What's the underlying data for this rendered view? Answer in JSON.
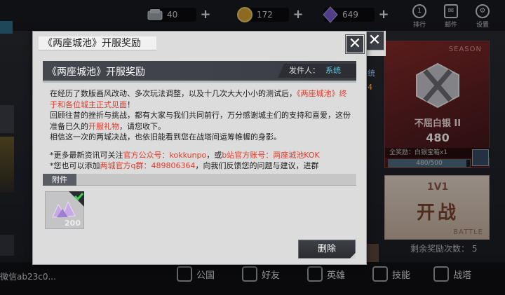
{
  "resources": [
    {
      "name": "silver",
      "value": "40",
      "icon": "silver-ingot-icon"
    },
    {
      "name": "gold",
      "value": "172",
      "icon": "gold-coin-icon"
    },
    {
      "name": "gem",
      "value": "649",
      "icon": "purple-gem-icon"
    }
  ],
  "top_buttons": [
    {
      "label": "排行",
      "icon": "ranking-icon",
      "glyph": "1"
    },
    {
      "label": "邮件",
      "icon": "mail-icon",
      "glyph": "✉"
    },
    {
      "label": "设置",
      "icon": "settings-icon",
      "glyph": "⚙"
    }
  ],
  "rank_card": {
    "season": "SEASON",
    "rank_name": "不屈白银 II",
    "score": "480",
    "reward_text": "全奖励：白银宝箱x1",
    "progress_text": "480/500",
    "progress_fraction": 0.96
  },
  "battle_card": {
    "mode": "1V1",
    "action": "开战",
    "tag": "BATTLE"
  },
  "remaining": "剩余奖励次数： 5",
  "username": "微信ab23c0...",
  "bottom_nav": [
    {
      "label": "公国",
      "icon": "crown-icon"
    },
    {
      "label": "好友",
      "icon": "friends-icon"
    },
    {
      "label": "英雄",
      "icon": "hero-icon"
    },
    {
      "label": "技能",
      "icon": "skill-icon"
    },
    {
      "label": "战塔",
      "icon": "tower-icon"
    }
  ],
  "back_panel": {
    "side_text": "统",
    "side_num": "4"
  },
  "dialog": {
    "title": "《两座城池》开服奖励",
    "close_symbol": "✕",
    "mail_title": "《两座城池》开服奖励",
    "sender_label": "发件人：",
    "sender_name": "系统",
    "body": {
      "p1_a": "在经历了数版画风改动、多次玩法调整，以及十几次大大小小的测试后，",
      "p1_hl": "《两座城池》终于和各位城主正式见面",
      "p1_b": "！",
      "p2_a": "回顾往昔的挫折与挑战，都有大家与我们共同前行，万分感谢城主们的支持和喜爱，这份准备已久的",
      "p2_hl": "开服礼物",
      "p2_b": "，请您收下。",
      "p3": "相信这一次的两城决战，也依旧能看到您在战塔间运筹帷幄的身影。",
      "p4_a": "*更多最新资讯可关注",
      "p4_hl1": "官方公众号：kokkunpo",
      "p4_b": "，或",
      "p4_hl2": "b站官方账号：两座城池KOK",
      "p5_a": "*您也可以添加",
      "p5_hl": "两城官方q群：489806364",
      "p5_b": "，向我们反馈您的问题与建议，进群"
    },
    "attachment_label": "附件",
    "attachment_qty": "200",
    "attachment_icon": "crystal-icon",
    "delete_label": "删除"
  }
}
